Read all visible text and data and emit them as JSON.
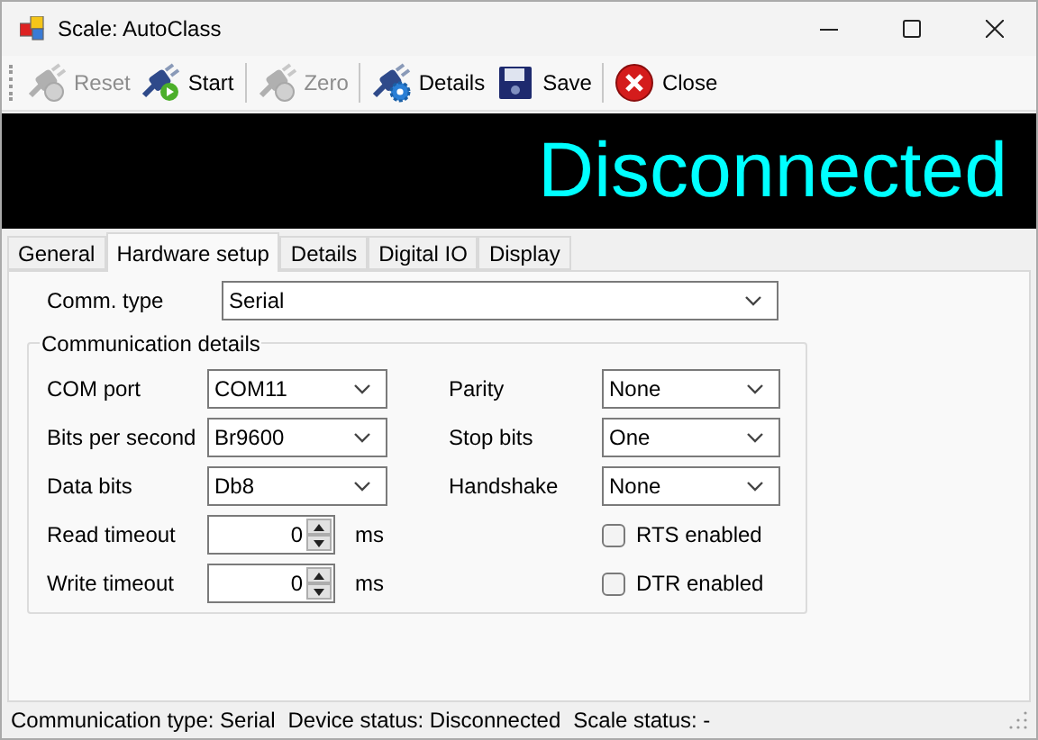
{
  "window": {
    "title": "Scale: AutoClass"
  },
  "toolbar": {
    "groups": [
      [
        {
          "label": "Reset",
          "kind": "plug-reset",
          "disabled": true
        },
        {
          "label": "Start",
          "kind": "plug-start",
          "disabled": false
        }
      ],
      [
        {
          "label": "Zero",
          "kind": "plug-zero",
          "disabled": true
        }
      ],
      [
        {
          "label": "Details",
          "kind": "plug-gear",
          "disabled": false
        },
        {
          "label": "Save",
          "kind": "floppy",
          "disabled": false
        }
      ],
      [
        {
          "label": "Close",
          "kind": "close",
          "disabled": false
        }
      ]
    ]
  },
  "display": {
    "text": "Disconnected"
  },
  "tabs": [
    {
      "label": "General",
      "selected": false
    },
    {
      "label": "Hardware setup",
      "selected": true
    },
    {
      "label": "Details",
      "selected": false
    },
    {
      "label": "Digital IO",
      "selected": false
    },
    {
      "label": "Display",
      "selected": false
    }
  ],
  "comm_type": {
    "label": "Comm. type",
    "value": "Serial"
  },
  "group": {
    "title": "Communication details",
    "left": [
      {
        "kind": "dropdown",
        "label": "COM port",
        "value": "COM11"
      },
      {
        "kind": "dropdown",
        "label": "Bits per second",
        "value": "Br9600"
      },
      {
        "kind": "dropdown",
        "label": "Data bits",
        "value": "Db8"
      },
      {
        "kind": "spinner",
        "label": "Read timeout",
        "value": "0",
        "unit": "ms"
      },
      {
        "kind": "spinner",
        "label": "Write timeout",
        "value": "0",
        "unit": "ms"
      }
    ],
    "right": [
      {
        "kind": "dropdown",
        "label": "Parity",
        "value": "None"
      },
      {
        "kind": "dropdown",
        "label": "Stop bits",
        "value": "One"
      },
      {
        "kind": "dropdown",
        "label": "Handshake",
        "value": "None"
      },
      {
        "kind": "checkbox",
        "label": "RTS enabled",
        "checked": false
      },
      {
        "kind": "checkbox",
        "label": "DTR enabled",
        "checked": false
      }
    ]
  },
  "status_bar": [
    "Communication type: Serial",
    "Device status: Disconnected",
    "Scale status: -"
  ]
}
